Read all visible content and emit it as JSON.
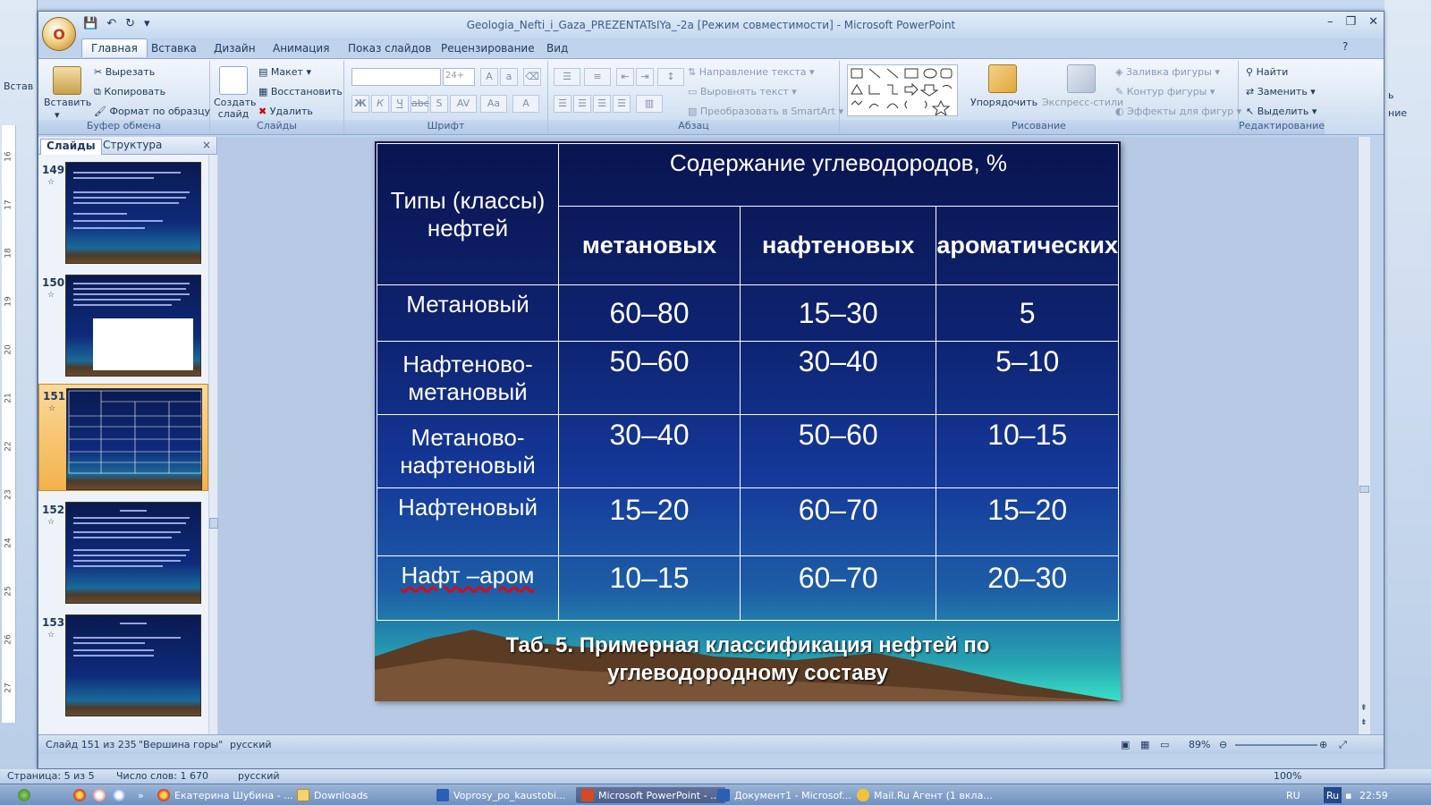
{
  "window": {
    "title": "Geologia_Nefti_i_Gaza_PREZENTATsIYa_-2a [Режим совместимости] - Microsoft PowerPoint",
    "office_letter": "O"
  },
  "bg_left_label": "Встав",
  "bg_right": {
    "a": "ь",
    "b": "ние"
  },
  "tabs": [
    "Главная",
    "Вставка",
    "Дизайн",
    "Анимация",
    "Показ слайдов",
    "Рецензирование",
    "Вид"
  ],
  "ribbon": {
    "clipboard": {
      "paste": "Вставить",
      "cut": "Вырезать",
      "copy": "Копировать",
      "format_painter": "Формат по образцу",
      "label": "Буфер обмена"
    },
    "slides": {
      "new_slide": "Создать слайд",
      "layout": "Макет",
      "reset": "Восстановить",
      "delete": "Удалить",
      "label": "Слайды"
    },
    "font": {
      "font_size": "24+",
      "label": "Шрифт"
    },
    "paragraph": {
      "direction": "Направление текста",
      "align": "Выровнять текст",
      "smartart": "Преобразовать в SmartArt",
      "label": "Абзац"
    },
    "drawing": {
      "arrange": "Упорядочить",
      "quick_styles": "Экспресс-стили",
      "fill": "Заливка фигуры",
      "outline": "Контур фигуры",
      "effects": "Эффекты для фигур",
      "label": "Рисование"
    },
    "editing": {
      "find": "Найти",
      "replace": "Заменить",
      "select": "Выделить",
      "label": "Редактирование"
    }
  },
  "panel": {
    "tab_slides": "Слайды",
    "tab_outline": "Структура",
    "close": "×",
    "thumbs": [
      {
        "num": "149"
      },
      {
        "num": "150"
      },
      {
        "num": "151"
      },
      {
        "num": "152"
      },
      {
        "num": "153"
      }
    ]
  },
  "ruler_marks": [
    "16",
    "17",
    "18",
    "19",
    "20",
    "21",
    "22",
    "23",
    "24",
    "25",
    "26",
    "27"
  ],
  "slide": {
    "col_type_header": "Типы (классы) нефтей",
    "content_header": "Содержание углеводородов, %",
    "sub_headers": [
      "метановых",
      "нафтеновых",
      "ароматических"
    ],
    "rows": [
      {
        "type": "Метановый",
        "values": [
          "60–80",
          "15–30",
          "5"
        ]
      },
      {
        "type": "Нафтеново-метановый",
        "values": [
          "50–60",
          "30–40",
          "5–10"
        ]
      },
      {
        "type": "Метаново-нафтеновый",
        "values": [
          "30–40",
          "50–60",
          "10–15"
        ]
      },
      {
        "type": "Нафтеновый",
        "values": [
          "15–20",
          "60–70",
          "15–20"
        ]
      },
      {
        "type": "Нафт –аром",
        "values": [
          "10–15",
          "60–70",
          "20–30"
        ]
      }
    ],
    "caption_line1": "Таб. 5. Примерная классификация нефтей по",
    "caption_line2": "углеводородному составу"
  },
  "status": {
    "slide": "Слайд 151 из 235",
    "theme": "\"Вершина горы\"",
    "lang": "русский",
    "zoom": "89%"
  },
  "word_status": {
    "page": "Страница: 5 из 5",
    "words": "Число слов: 1 670",
    "lang": "русский",
    "zoom": "100%"
  },
  "taskbar": {
    "items": [
      "Екатерина Шубина - ...",
      "Downloads",
      "Voprosy_po_kaustobi...",
      "Microsoft PowerPoint - ...",
      "Документ1 - Microsof...",
      "Mail.Ru Агент (1 вкла..."
    ],
    "lang": "RU",
    "lang2": "Ru",
    "clock": "22:59"
  }
}
